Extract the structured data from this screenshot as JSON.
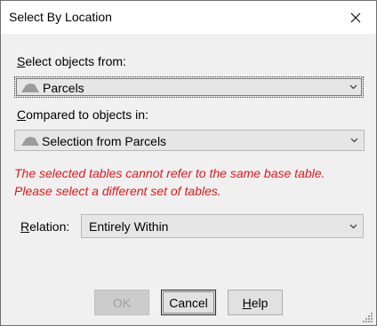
{
  "window": {
    "title": "Select By Location",
    "close_icon": "close-icon"
  },
  "select_from": {
    "label_accel": "S",
    "label_rest": "elect objects from:",
    "value": "Parcels",
    "icon": "polygon-layer-icon"
  },
  "compared_to": {
    "label_accel": "C",
    "label_rest": "ompared to objects in:",
    "value": "Selection from Parcels",
    "icon": "polygon-layer-icon"
  },
  "error": {
    "line1": "The selected tables cannot refer to the same base table.",
    "line2": "Please select a different set of tables.",
    "color": "#e8161c"
  },
  "relation": {
    "label_accel": "R",
    "label_rest": "elation:",
    "value": "Entirely Within"
  },
  "buttons": {
    "ok": "OK",
    "cancel": "Cancel",
    "help_accel": "H",
    "help_rest": "elp"
  }
}
